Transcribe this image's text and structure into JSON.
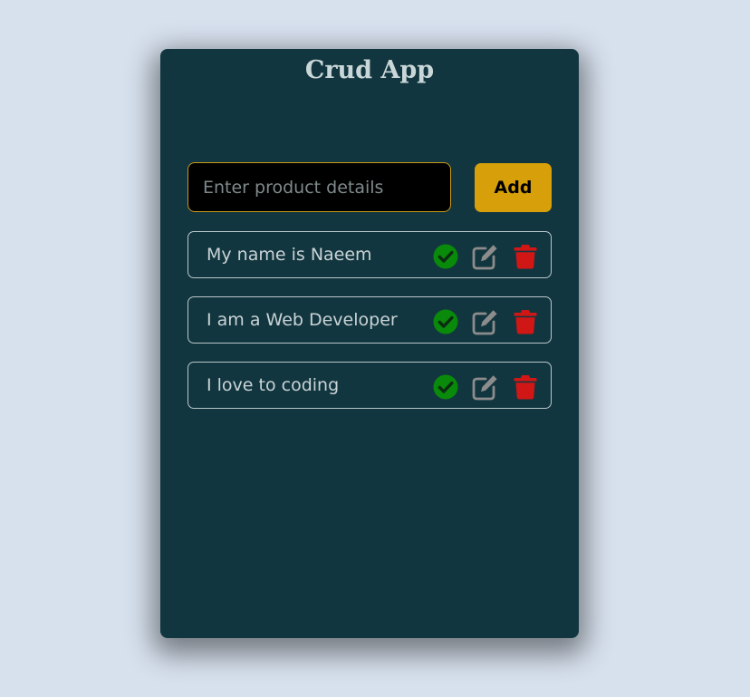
{
  "app": {
    "title": "Crud App"
  },
  "form": {
    "input_placeholder": "Enter product details",
    "input_value": "",
    "add_label": "Add"
  },
  "todos": [
    {
      "text": "My name is Naeem"
    },
    {
      "text": "I am a Web Developer"
    },
    {
      "text": "I love to coding"
    }
  ],
  "icons": {
    "complete": "check-circle-icon",
    "edit": "edit-icon",
    "delete": "trash-icon"
  },
  "colors": {
    "page_background": "#d7e1ee",
    "card_background": "#12363f",
    "accent": "#d7a00a",
    "check": "#0a8a0a",
    "edit": "#8c8c8c",
    "delete": "#d11616"
  }
}
